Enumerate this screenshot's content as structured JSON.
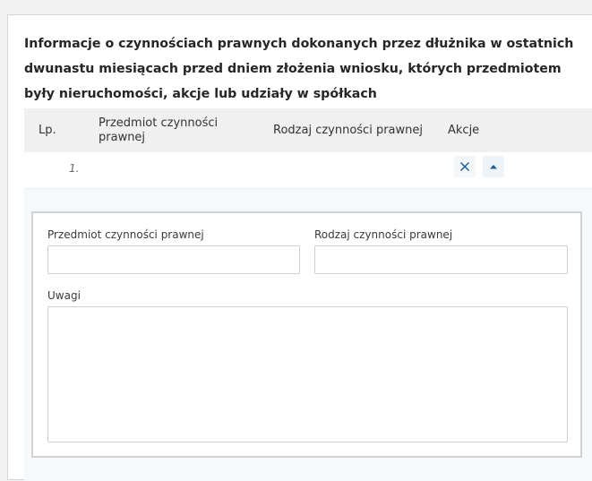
{
  "section": {
    "title": "Informacje o czynnościach prawnych dokonanych przez dłużnika w ostatnich dwunastu miesiącach przed dniem złożenia wniosku, których przedmiotem były nieruchomości, akcje lub udziały w spółkach"
  },
  "table": {
    "headers": {
      "lp": "Lp.",
      "subject": "Przedmiot czynności prawnej",
      "type": "Rodzaj czynności prawnej",
      "actions": "Akcje"
    },
    "rows": [
      {
        "number": "1."
      }
    ]
  },
  "detail": {
    "subject_label": "Przedmiot czynności prawnej",
    "subject_value": "",
    "type_label": "Rodzaj czynności prawnej",
    "type_value": "",
    "notes_label": "Uwagi",
    "notes_value": ""
  },
  "icons": {
    "delete": "close-icon",
    "collapse": "caret-up-icon"
  },
  "colors": {
    "accent": "#1f5c99",
    "header_bg": "#f0f0f0",
    "detail_bg": "#f5f9fc"
  }
}
